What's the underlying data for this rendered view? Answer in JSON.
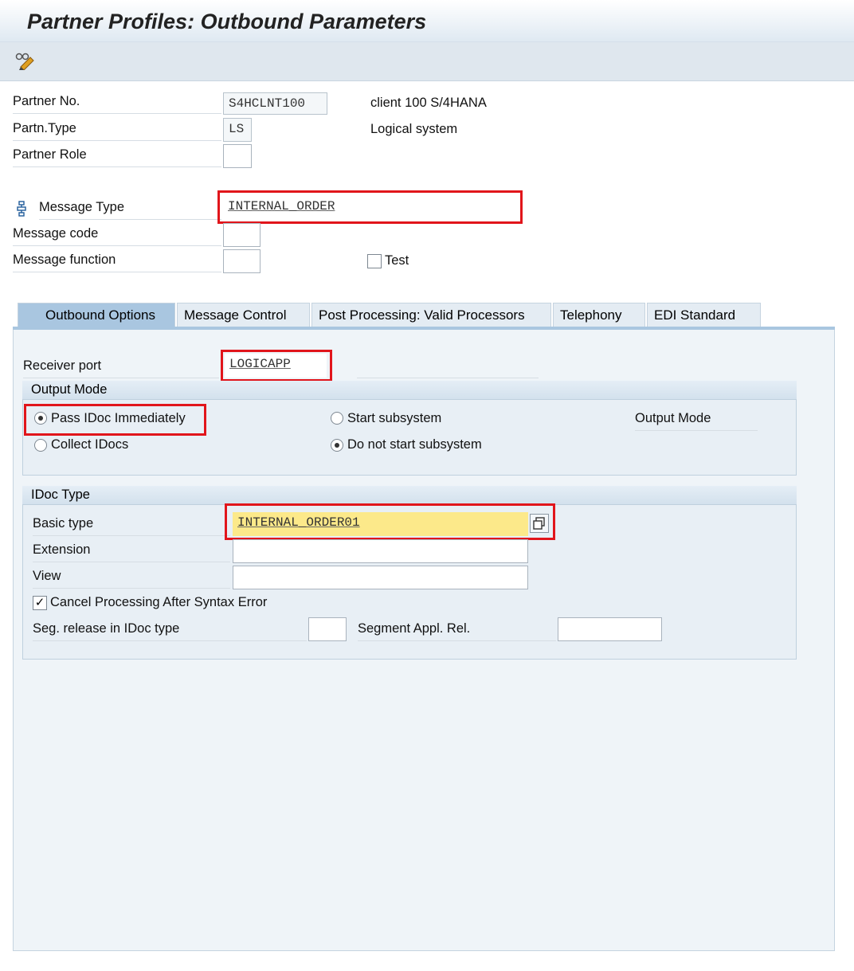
{
  "title": "Partner Profiles: Outbound Parameters",
  "toolbar": {
    "icon": "display-change-icon"
  },
  "header": {
    "partner_no_label": "Partner No.",
    "partner_no_value": "S4HCLNT100",
    "partner_no_desc": "client 100 S/4HANA",
    "partn_type_label": "Partn.Type",
    "partn_type_value": "LS",
    "partn_type_desc": "Logical system",
    "partner_role_label": "Partner Role",
    "partner_role_value": "",
    "message_type_label": "Message Type",
    "message_type_value": "INTERNAL_ORDER",
    "message_code_label": "Message code",
    "message_code_value": "",
    "message_function_label": "Message function",
    "message_function_value": "",
    "test_label": "Test",
    "test_checked": false
  },
  "tabs": [
    {
      "label": "Outbound Options",
      "active": true
    },
    {
      "label": "Message Control",
      "active": false
    },
    {
      "label": "Post Processing: Valid Processors",
      "active": false
    },
    {
      "label": "Telephony",
      "active": false
    },
    {
      "label": "EDI Standard",
      "active": false
    }
  ],
  "outbound": {
    "receiver_port_label": "Receiver port",
    "receiver_port_value": "LOGICAPP",
    "output_mode": {
      "title": "Output Mode",
      "pass_immediately_label": "Pass IDoc Immediately",
      "collect_label": "Collect IDocs",
      "start_subsystem_label": "Start subsystem",
      "do_not_start_label": "Do not start subsystem",
      "output_mode_label": "Output Mode",
      "selected_transfer": "Pass IDoc Immediately",
      "selected_subsystem": "Do not start subsystem"
    },
    "idoc_type": {
      "title": "IDoc Type",
      "basic_type_label": "Basic type",
      "basic_type_value": "INTERNAL_ORDER01",
      "extension_label": "Extension",
      "extension_value": "",
      "view_label": "View",
      "view_value": "",
      "cancel_label": "Cancel Processing After Syntax Error",
      "cancel_checked": true,
      "seg_release_label": "Seg. release in IDoc type",
      "seg_release_value": "",
      "segment_appl_label": "Segment Appl. Rel.",
      "segment_appl_value": ""
    }
  },
  "colors": {
    "highlight": "#e1151b",
    "active_tab": "#a9c6e0",
    "focus_field": "#fce98a"
  }
}
